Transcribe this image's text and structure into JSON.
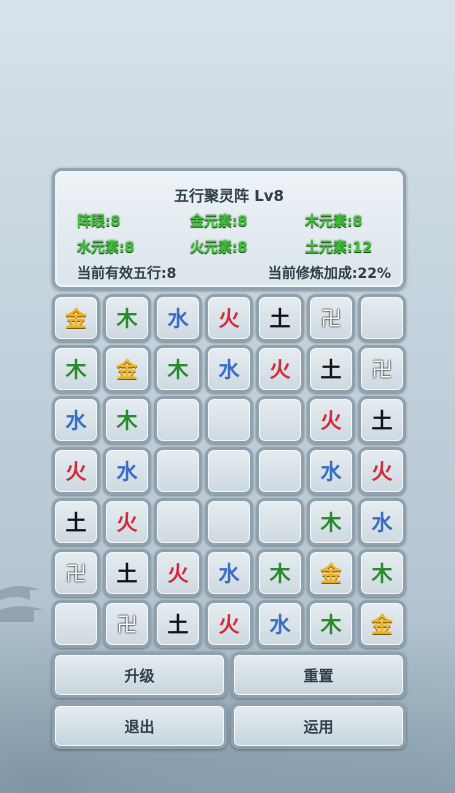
{
  "formation": {
    "title": "五行聚灵阵 Lv8",
    "stats": [
      {
        "label": "阵眼:8"
      },
      {
        "label": "金元素:8"
      },
      {
        "label": "木元素:8"
      },
      {
        "label": "水元素:8"
      },
      {
        "label": "火元素:8"
      },
      {
        "label": "土元素:12"
      }
    ],
    "active_elements": "当前有效五行:8",
    "cultivation_bonus": "当前修炼加成:22%"
  },
  "grid": [
    [
      "金",
      "木",
      "水",
      "火",
      "土",
      "卍",
      ""
    ],
    [
      "木",
      "金",
      "木",
      "水",
      "火",
      "土",
      "卍"
    ],
    [
      "水",
      "木",
      "",
      "",
      "",
      "火",
      "土"
    ],
    [
      "火",
      "水",
      "",
      "",
      "",
      "水",
      "火"
    ],
    [
      "土",
      "火",
      "",
      "",
      "",
      "木",
      "水"
    ],
    [
      "卍",
      "土",
      "火",
      "水",
      "木",
      "金",
      "木"
    ],
    [
      "",
      "卍",
      "土",
      "火",
      "水",
      "木",
      "金"
    ]
  ],
  "buttons": {
    "upgrade": "升级",
    "reset": "重置",
    "exit": "退出",
    "apply": "运用"
  },
  "colors": {
    "金": "#f2b51d",
    "木": "#2a8a2e",
    "水": "#3b6dc4",
    "火": "#d22c3c",
    "土": "#111111",
    "stat_text": "#3fc23a"
  }
}
